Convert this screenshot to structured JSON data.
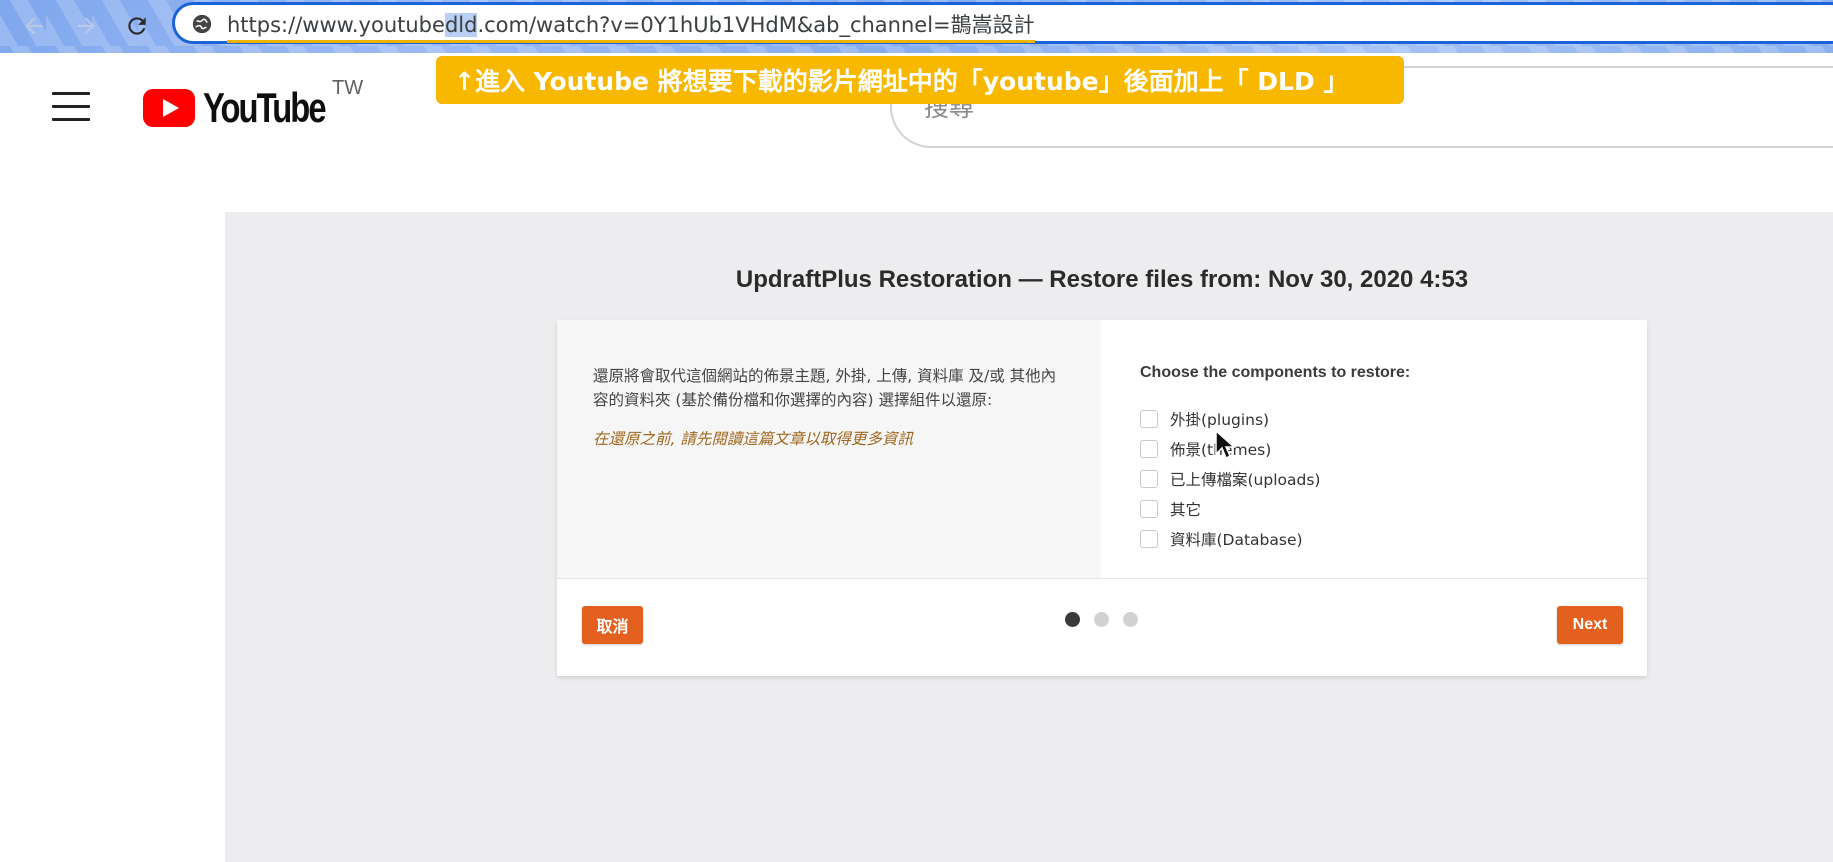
{
  "browser": {
    "url_prefix": "https://www.youtube",
    "url_selected": "dld",
    "url_suffix": ".com/watch?v=0Y1hUb1VHdM&ab_channel=鵲嵩設計"
  },
  "icons": {
    "back": "arrow-left-icon",
    "forward": "arrow-right-icon",
    "reload": "reload-icon",
    "site_info": "site-info-icon",
    "menu": "hamburger-menu-icon",
    "logo": "youtube-play-logo-icon",
    "cursor": "mouse-pointer-icon"
  },
  "youtube": {
    "wordmark": "YouTube",
    "region": "TW",
    "search_placeholder": "搜尋"
  },
  "annotation": {
    "banner_text": "↑進入 Youtube 將想要下載的影片網址中的「youtube」後面加上「 DLD 」"
  },
  "restore_dialog": {
    "title": "UpdraftPlus Restoration — Restore files from: Nov 30, 2020 4:53",
    "description": "還原將會取代這個網站的佈景主題, 外掛, 上傳, 資料庫 及/或 其他內容的資料夾 (基於備份檔和你選擇的內容) 選擇組件以還原:",
    "warning_link": "在還原之前, 請先閱讀這篇文章以取得更多資訊",
    "choose_label": "Choose the components to restore:",
    "components": [
      {
        "label": "外掛(plugins)",
        "checked": false
      },
      {
        "label": "佈景(themes)",
        "checked": false
      },
      {
        "label": "已上傳檔案(uploads)",
        "checked": false
      },
      {
        "label": "其它",
        "checked": false
      },
      {
        "label": "資料庫(Database)",
        "checked": false
      }
    ],
    "cancel_label": "取消",
    "next_label": "Next",
    "step_count": 3,
    "current_step": 1
  },
  "colors": {
    "accent_orange": "#e3601f",
    "banner_yellow": "#f8b800",
    "url_border_blue": "#1a63d8",
    "youtube_red": "#ff0000"
  }
}
